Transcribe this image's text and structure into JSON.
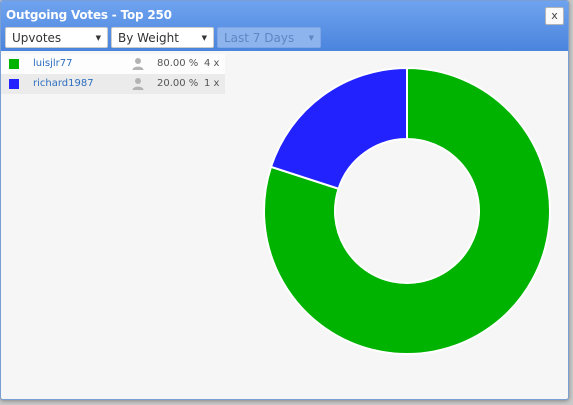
{
  "window": {
    "title": "Outgoing Votes - Top 250",
    "close_label": "x"
  },
  "filters": {
    "vote_type": "Upvotes",
    "sort": "By Weight",
    "period": "Last 7 Days"
  },
  "voters": [
    {
      "name": "luisjlr77",
      "percent": "80.00 %",
      "count": "4 x",
      "color": "#00b300",
      "value": 80
    },
    {
      "name": "richard1987",
      "percent": "20.00 %",
      "count": "1 x",
      "color": "#2222ff",
      "value": 20
    }
  ],
  "chart_data": {
    "type": "pie",
    "categories": [
      "luisjlr77",
      "richard1987"
    ],
    "values": [
      80,
      20
    ],
    "colors": [
      "#00b300",
      "#2222ff"
    ],
    "donut": true
  }
}
